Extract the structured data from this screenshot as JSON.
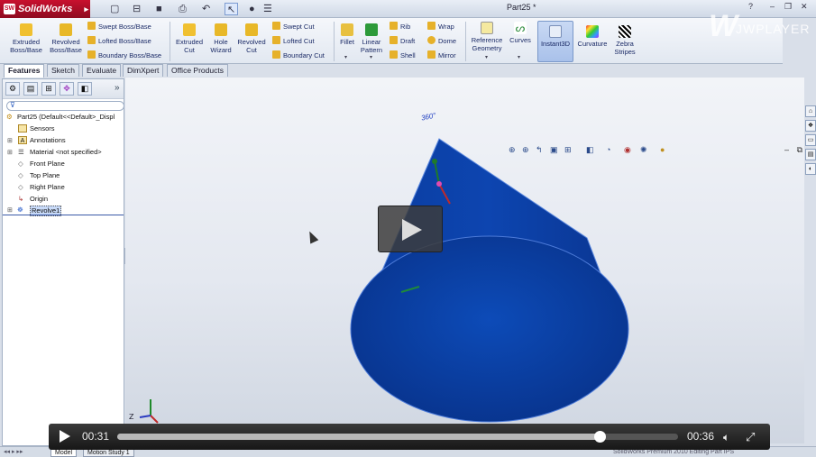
{
  "app": {
    "name": "SolidWorks",
    "doc_title": "Part25 *"
  },
  "command_manager": {
    "extruded_boss": "Extruded Boss/Base",
    "revolved_boss": "Revolved Boss/Base",
    "swept_boss": "Swept Boss/Base",
    "lofted_boss": "Lofted Boss/Base",
    "boundary_boss": "Boundary Boss/Base",
    "extruded_cut": "Extruded Cut",
    "hole_wizard": "Hole Wizard",
    "revolved_cut": "Revolved Cut",
    "swept_cut": "Swept Cut",
    "lofted_cut": "Lofted Cut",
    "boundary_cut": "Boundary Cut",
    "fillet": "Fillet",
    "linear_pattern": "Linear Pattern",
    "rib": "Rib",
    "draft": "Draft",
    "shell": "Shell",
    "wrap": "Wrap",
    "dome": "Dome",
    "mirror": "Mirror",
    "reference_geometry": "Reference Geometry",
    "curves": "Curves",
    "instant3d": "Instant3D",
    "curvature": "Curvature",
    "zebra_stripes": "Zebra Stripes"
  },
  "tabs": [
    "Features",
    "Sketch",
    "Evaluate",
    "DimXpert",
    "Office Products"
  ],
  "feature_tree": {
    "root": "Part25  (Default<<Default>_Displ",
    "items": [
      "Sensors",
      "Annotations",
      "Material <not specified>",
      "Front Plane",
      "Top Plane",
      "Right Plane",
      "Origin",
      "Revolve1"
    ]
  },
  "viewport": {
    "angle_label": "360°"
  },
  "bottom_tabs": [
    "Model",
    "Motion Study 1"
  ],
  "status_text": "SolidWorks Premium 2010   Editing Part   IPS",
  "player": {
    "current_time": "00:31",
    "duration": "00:36",
    "progress": 0.86,
    "brand": "JWPLAYER"
  },
  "colors": {
    "cone": "#0a3a9a",
    "accent": "#c8102e"
  }
}
